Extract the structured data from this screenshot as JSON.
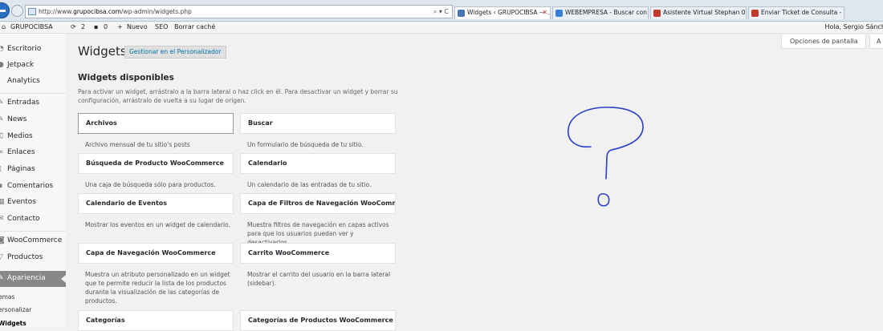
{
  "browser": {
    "url_prefix": "http://www.",
    "url_domain": "grupocibsa.com",
    "url_path": "/wp-admin/widgets.php",
    "addr_controls": "⌕ ▾ C",
    "tabs": [
      {
        "label": "Widgets ‹ GRUPOCIBSA — ...",
        "close": "✕",
        "color": "#4a76b8"
      },
      {
        "label": "WEBEMPRESA - Buscar con Go...",
        "color": "#3b7ddd"
      },
      {
        "label": "Asistente Virtual Stephan 0.4 - ...",
        "color": "#c0392b"
      },
      {
        "label": "Enviar Ticket de Consulta - we...",
        "color": "#c0392b"
      }
    ]
  },
  "adminbar": {
    "site_name": "GRUPOCIBSA",
    "updates": "2",
    "comments": "0",
    "new_label": "Nuevo",
    "seo_label": "SEO",
    "cache_label": "Borrar caché",
    "greeting": "Hola, Sergio Sánch"
  },
  "sidebar": {
    "items": [
      {
        "label": "Escritorio",
        "icon": "dashboard-icon"
      },
      {
        "label": "Jetpack",
        "icon": "jetpack-icon"
      },
      {
        "label": "Analytics",
        "icon": "analytics-icon"
      },
      {
        "label": "Entradas",
        "icon": "pin-icon"
      },
      {
        "label": "News",
        "icon": "news-icon"
      },
      {
        "label": "Medios",
        "icon": "media-icon"
      },
      {
        "label": "Enlaces",
        "icon": "link-icon"
      },
      {
        "label": "Páginas",
        "icon": "page-icon"
      },
      {
        "label": "Comentarios",
        "icon": "comment-icon"
      },
      {
        "label": "Eventos",
        "icon": "events-icon"
      },
      {
        "label": "Contacto",
        "icon": "contact-icon"
      },
      {
        "label": "WooCommerce",
        "icon": "woocommerce-icon"
      },
      {
        "label": "Productos",
        "icon": "products-icon"
      },
      {
        "label": "Apariencia",
        "icon": "appearance-icon"
      }
    ],
    "subitems": [
      "emas",
      "ersonalizar",
      "Widgets"
    ]
  },
  "page": {
    "title": "Widgets",
    "manage_label": "Gestionar en el Personalizador",
    "screen_options": "Opciones de pantalla",
    "help_truncated": "A"
  },
  "available": {
    "heading": "Widgets disponibles",
    "description": "Para activar un widget, arrástralo a la barra lateral o haz click en él. Para desactivar un widget y borrar su configuración, arrástralo de vuelta a su lugar de origen.",
    "widgets": [
      {
        "title": "Archivos",
        "desc": "Archivo mensual de tu sitio's posts"
      },
      {
        "title": "Buscar",
        "desc": "Un formulario de búsqueda de tu sitio."
      },
      {
        "title": "Búsqueda de Producto WooCommerce",
        "desc": "Una caja de búsqueda sólo para productos."
      },
      {
        "title": "Calendario",
        "desc": "Un calendario de las entradas de tu sitio."
      },
      {
        "title": "Calendario de Eventos",
        "desc": "Mostrar los eventos en un widget de calendario."
      },
      {
        "title": "Capa de Filtros de Navegación WooCommer...",
        "desc": "Muestra filtros de navegación en capas activos para que los usuarios puedan ver y desactivarlos."
      },
      {
        "title": "Capa de Navegación WooCommerce",
        "desc": "Muestra un atributo personalizado en un widget que te permite reducir la lista de los productos durante la visualización de las categorías de productos."
      },
      {
        "title": "Carrito WooCommerce",
        "desc": "Mostrar el carrito del usuario en la barra lateral (sidebar)."
      },
      {
        "title": "Categorías",
        "desc": ""
      },
      {
        "title": "Categorías de Productos WooCommerce",
        "desc": ""
      }
    ]
  }
}
